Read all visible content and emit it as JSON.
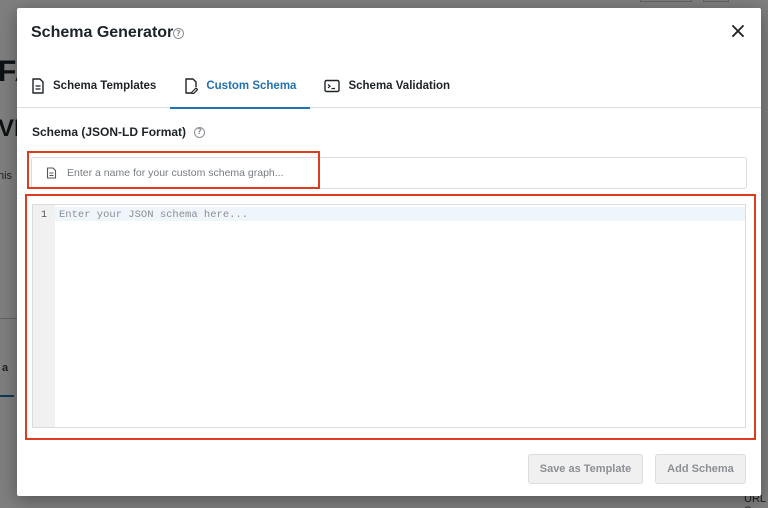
{
  "modal": {
    "title": "Schema Generator",
    "close_glyph": "×",
    "help_glyph": "?"
  },
  "tabs": [
    {
      "label": "Schema Templates",
      "icon": "document-icon",
      "active": false
    },
    {
      "label": "Custom Schema",
      "icon": "edit-document-icon",
      "active": true
    },
    {
      "label": "Schema Validation",
      "icon": "terminal-icon",
      "active": false
    }
  ],
  "schema_section": {
    "label": "Schema (JSON-LD Format)"
  },
  "name_input": {
    "placeholder": "Enter a name for your custom schema graph...",
    "value": ""
  },
  "code_editor": {
    "line_number": "1",
    "placeholder": "Enter your JSON schema here...",
    "value": ""
  },
  "footer": {
    "save_label": "Save as Template",
    "add_label": "Add Schema"
  },
  "background": {
    "fragment_f": "FA",
    "fragment_v": "VI",
    "fragment_this": "his",
    "fragment_a": "a",
    "fragment_url": "URL S"
  },
  "colors": {
    "accent": "#2271b1",
    "highlight_box": "#e03a1f"
  }
}
